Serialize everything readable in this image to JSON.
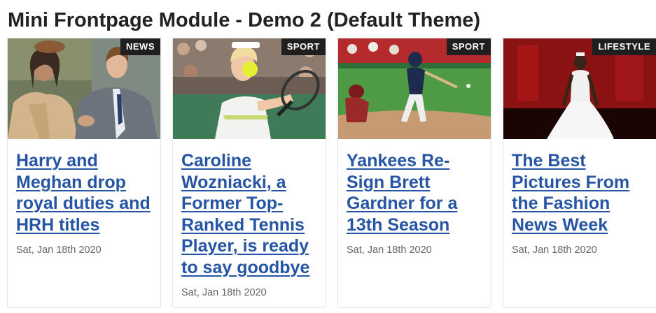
{
  "module": {
    "title": "Mini Frontpage Module - Demo 2 (Default Theme)"
  },
  "articles": [
    {
      "category": "NEWS",
      "title": "Harry and Meghan drop royal duties and HRH titles",
      "date": "Sat, Jan 18th 2020",
      "image": "couple-photo"
    },
    {
      "category": "SPORT",
      "title": "Caroline Wozniacki, a Former Top-Ranked Tennis Player, is ready to say goodbye",
      "date": "Sat, Jan 18th 2020",
      "image": "tennis-photo"
    },
    {
      "category": "SPORT",
      "title": "Yankees Re-Sign Brett Gardner for a 13th Season",
      "date": "Sat, Jan 18th 2020",
      "image": "baseball-photo"
    },
    {
      "category": "LIFESTYLE",
      "title": "The Best Pictures From the Fashion News Week",
      "date": "Sat, Jan 18th 2020",
      "image": "fashion-photo"
    }
  ],
  "colors": {
    "link": "#2655a6",
    "badge_bg": "#1f1f1f",
    "date_text": "#666666"
  }
}
